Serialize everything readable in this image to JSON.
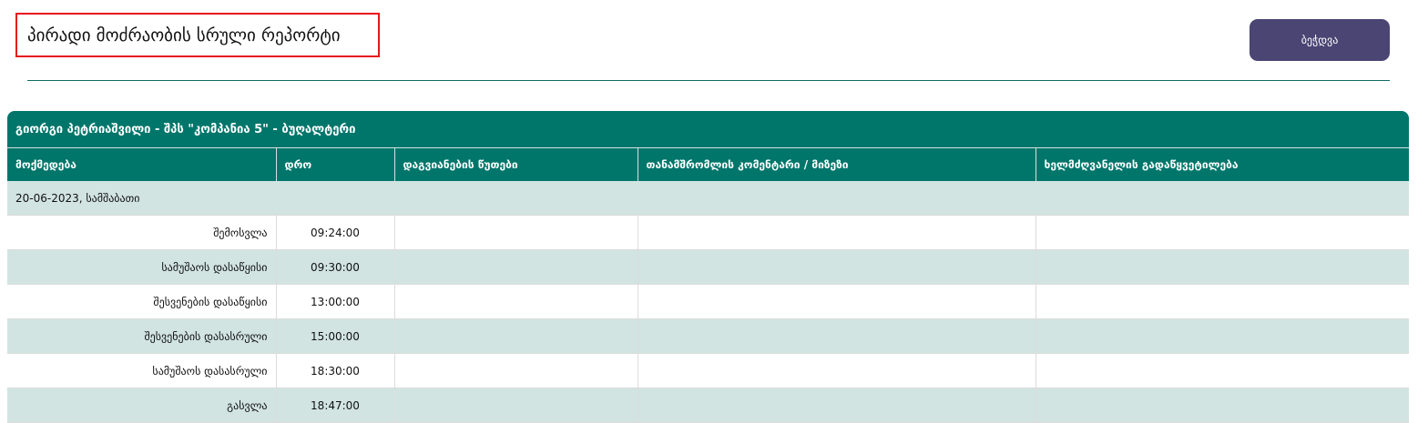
{
  "header": {
    "title": "პირადი მოძრაობის სრული რეპორტი",
    "print_label": "ბეჭდვა"
  },
  "report": {
    "caption": "გიორგი პეტრიაშვილი - შპს \"კომპანია 5\" - ბუღალტერი",
    "columns": [
      "მოქმედება",
      "დრო",
      "დაგვიანების წუთები",
      "თანამშრომლის კომენტარი / მიზეზი",
      "ხელმძღვანელის გადაწყვეტილება"
    ],
    "date_label": "20-06-2023, სამშაბათი",
    "rows": [
      {
        "action": "შემოსვლა",
        "time": "09:24:00",
        "late": "",
        "comment": "",
        "decision": ""
      },
      {
        "action": "სამუშაოს დასაწყისი",
        "time": "09:30:00",
        "late": "",
        "comment": "",
        "decision": ""
      },
      {
        "action": "შესვენების დასაწყისი",
        "time": "13:00:00",
        "late": "",
        "comment": "",
        "decision": ""
      },
      {
        "action": "შესვენების დასასრული",
        "time": "15:00:00",
        "late": "",
        "comment": "",
        "decision": ""
      },
      {
        "action": "სამუშაოს დასასრული",
        "time": "18:30:00",
        "late": "",
        "comment": "",
        "decision": ""
      },
      {
        "action": "გასვლა",
        "time": "18:47:00",
        "late": "",
        "comment": "",
        "decision": ""
      }
    ]
  },
  "colors": {
    "table_header": "#00766b",
    "stripe": "#d1e4e2",
    "print_button": "#4a4573",
    "title_border": "#e8141b"
  }
}
